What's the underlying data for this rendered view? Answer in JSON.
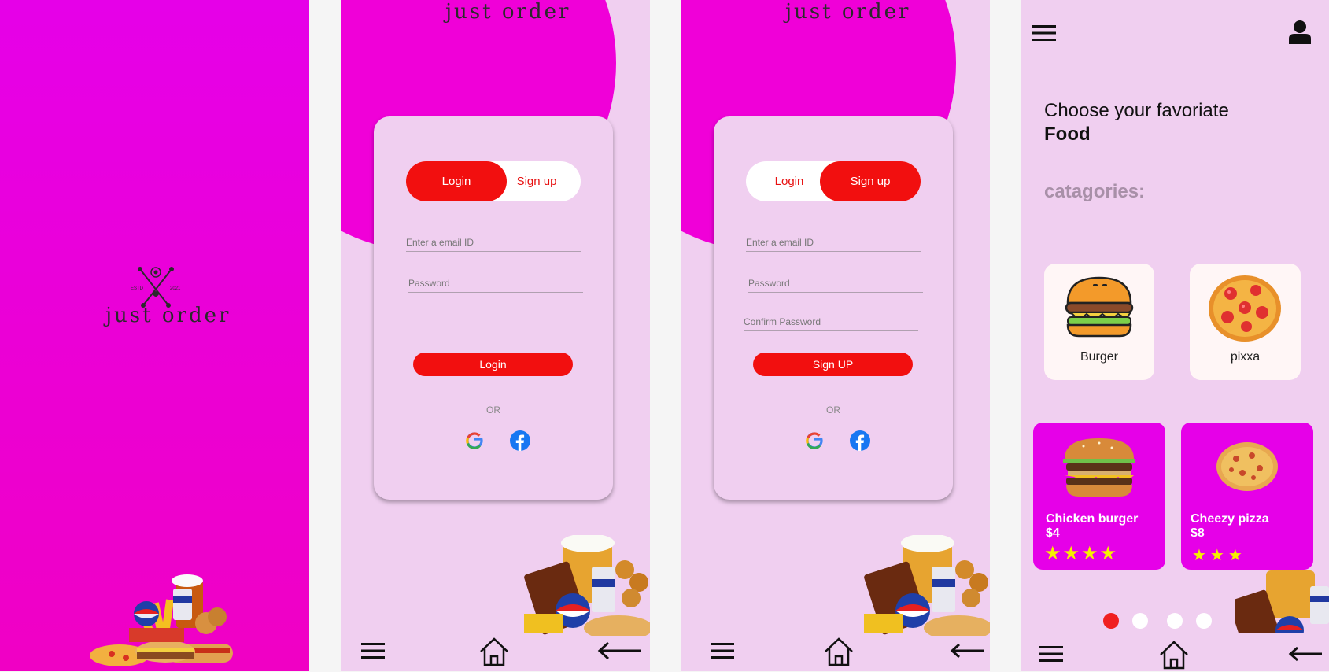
{
  "brand": {
    "logo_text": "just order",
    "logo_small_left": "ESTD",
    "logo_small_right": "2021"
  },
  "login_screen": {
    "tab_login": "Login",
    "tab_signup": "Sign up",
    "email_placeholder": "Enter a email ID",
    "password_placeholder": "Password",
    "submit_label": "Login",
    "or_text": "OR"
  },
  "signup_screen": {
    "tab_login": "Login",
    "tab_signup": "Sign up",
    "email_placeholder": "Enter a email ID",
    "password_placeholder": "Password",
    "confirm_placeholder": "Confirm Password",
    "submit_label": "Sign UP",
    "or_text": "OR"
  },
  "home_screen": {
    "heading_line1": "Choose your favoriate",
    "heading_line2": "Food",
    "categories_label": "catagories:",
    "categories": [
      {
        "label": "Burger",
        "icon": "burger-icon"
      },
      {
        "label": "pixxa",
        "icon": "pizza-icon"
      }
    ],
    "promos": [
      {
        "name": "Chicken burger",
        "price": "$4",
        "stars": "★★★★",
        "rating": 4
      },
      {
        "name": "Cheezy  pizza",
        "price": "$8",
        "stars": "★★★",
        "rating": 3
      }
    ],
    "carousel": {
      "pages": 4,
      "active": 1
    }
  },
  "icons": [
    "menu-icon",
    "home-icon",
    "back-arrow-icon",
    "user-icon",
    "google-icon",
    "facebook-icon"
  ],
  "colors": {
    "magenta": "#e600e8",
    "pink_bg": "#f0cff0",
    "red": "#f20f0f",
    "star": "#f5f000"
  }
}
